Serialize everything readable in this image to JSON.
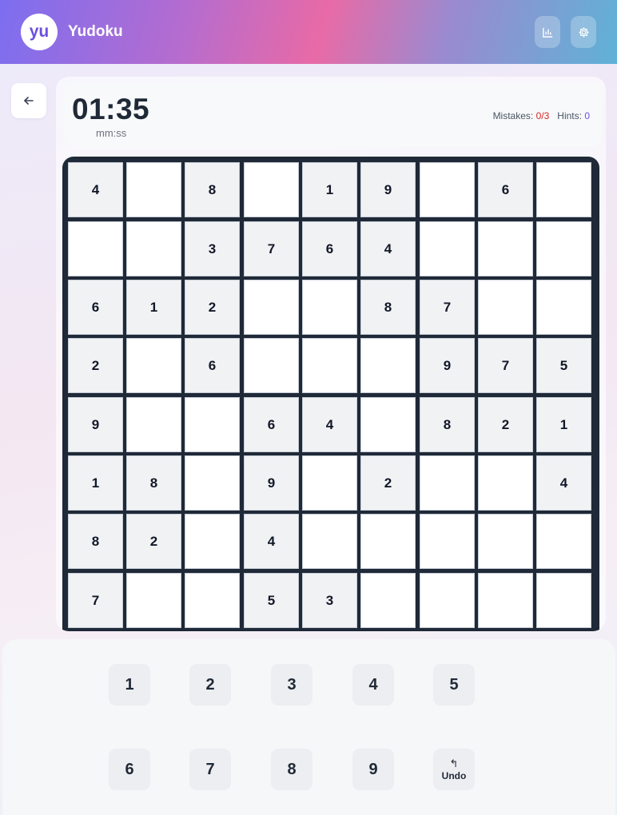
{
  "header": {
    "logo_text": "yu",
    "app_name": "Yudoku",
    "stats_icon": "bar-chart-icon",
    "settings_icon": "gear-icon"
  },
  "nav": {
    "back_icon": "arrow-left-icon"
  },
  "timer": {
    "value": "01:35",
    "unit": "mm:ss"
  },
  "stats": {
    "mistakes_label": "Mistakes:",
    "mistakes_value": "0/3",
    "hints_label": "Hints:",
    "hints_value": "0"
  },
  "board": {
    "rows": [
      [
        "4",
        "",
        "8",
        "",
        "1",
        "9",
        "",
        "6",
        ""
      ],
      [
        "",
        "",
        "3",
        "7",
        "6",
        "4",
        "",
        "",
        ""
      ],
      [
        "6",
        "1",
        "2",
        "",
        "",
        "8",
        "7",
        "",
        ""
      ],
      [
        "2",
        "",
        "6",
        "",
        "",
        "",
        "9",
        "7",
        "5"
      ],
      [
        "9",
        "",
        "",
        "6",
        "4",
        "",
        "8",
        "2",
        "1"
      ],
      [
        "1",
        "8",
        "",
        "9",
        "",
        "2",
        "",
        "",
        "4"
      ],
      [
        "8",
        "2",
        "",
        "4",
        "",
        "",
        "",
        "",
        ""
      ],
      [
        "7",
        "",
        "",
        "5",
        "3",
        "",
        "",
        "",
        ""
      ]
    ]
  },
  "keypad": {
    "keys": [
      "1",
      "2",
      "3",
      "4",
      "5",
      "6",
      "7",
      "8",
      "9"
    ],
    "undo_label": "Undo",
    "undo_icon": "undo-icon"
  },
  "colors": {
    "accent": "#6a4fe0",
    "mistakes": "#dc2626",
    "board_border": "#1f2937",
    "given_cell": "#f1f2f4"
  }
}
